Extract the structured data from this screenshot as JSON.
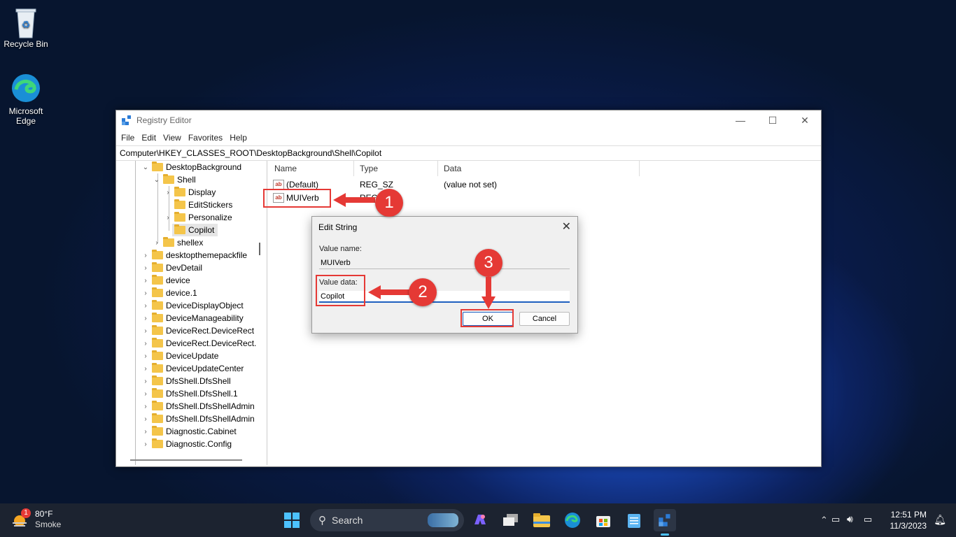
{
  "desktop": {
    "icons": [
      {
        "label": "Recycle Bin"
      },
      {
        "label_line1": "Microsoft",
        "label_line2": "Edge"
      }
    ]
  },
  "window": {
    "title": "Registry Editor",
    "menu": [
      "File",
      "Edit",
      "View",
      "Favorites",
      "Help"
    ],
    "address": "Computer\\HKEY_CLASSES_ROOT\\DesktopBackground\\Shell\\Copilot",
    "tree": [
      "DesktopBackground",
      "Shell",
      "Display",
      "EditStickers",
      "Personalize",
      "Copilot",
      "shellex",
      "desktopthemepackfile",
      "DevDetail",
      "device",
      "device.1",
      "DeviceDisplayObject",
      "DeviceManageability",
      "DeviceRect.DeviceRect",
      "DeviceRect.DeviceRect.",
      "DeviceUpdate",
      "DeviceUpdateCenter",
      "DfsShell.DfsShell",
      "DfsShell.DfsShell.1",
      "DfsShell.DfsShellAdmin",
      "DfsShell.DfsShellAdmin",
      "Diagnostic.Cabinet",
      "Diagnostic.Config"
    ],
    "columns": [
      "Name",
      "Type",
      "Data"
    ],
    "rows": [
      {
        "name": "(Default)",
        "type": "REG_SZ",
        "data": "(value not set)"
      },
      {
        "name": "MUIVerb",
        "type": "REG_SZ",
        "data": ""
      }
    ]
  },
  "dialog": {
    "title": "Edit String",
    "value_name_label": "Value name:",
    "value_name": "MUIVerb",
    "value_data_label": "Value data:",
    "value_data": "Copilot",
    "ok_label": "OK",
    "cancel_label": "Cancel"
  },
  "annotations": {
    "step1": "1",
    "step2": "2",
    "step3": "3",
    "color": "#e53935"
  },
  "taskbar": {
    "weather_temp": "80°F",
    "weather_desc": "Smoke",
    "weather_badge": "1",
    "search_label": "Search",
    "time": "12:51 PM",
    "date": "11/3/2023"
  }
}
